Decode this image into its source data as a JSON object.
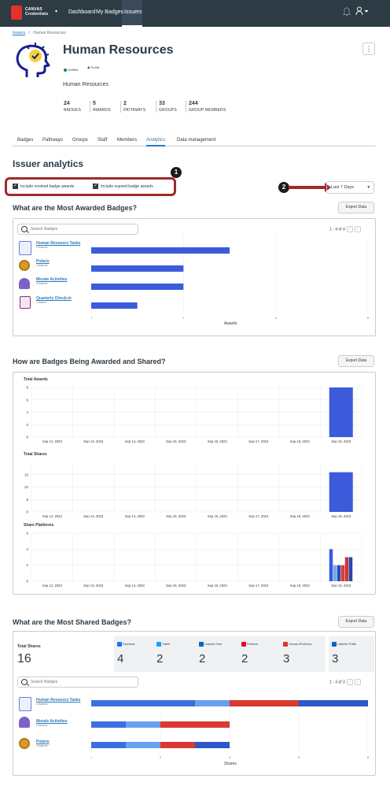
{
  "topbar": {
    "brand_line1": "CANVAS",
    "brand_line2": "Credentials",
    "nav": [
      "Dashboard",
      "My Badges",
      "Issuers"
    ]
  },
  "breadcrumb": {
    "root": "Issuers",
    "separator": "/",
    "current": "Human Resources"
  },
  "issuer": {
    "title": "Human Resources",
    "verified": "Verified",
    "visibility": "Public",
    "description": "Human Resources",
    "menu": "⋮"
  },
  "stats": [
    {
      "value": "24",
      "label": "BADGES"
    },
    {
      "value": "5",
      "label": "AWARDS"
    },
    {
      "value": "2",
      "label": "PATHWAYS"
    },
    {
      "value": "33",
      "label": "GROUPS"
    },
    {
      "value": "244",
      "label": "GROUP MEMBERS"
    }
  ],
  "tabs": [
    "Badges",
    "Pathways",
    "Groups",
    "Staff",
    "Members",
    "Analytics",
    "Data management"
  ],
  "active_tab": "Analytics",
  "analytics": {
    "heading": "Issuer analytics",
    "checkbox_revoked": "Include revoked badge awards",
    "checkbox_expired": "Include expired badge awards",
    "range_select": "Last 7 Days",
    "callout_1": "1",
    "callout_2": "2"
  },
  "most_awarded": {
    "heading": "What are the Most Awarded Badges?",
    "export": "Export Data",
    "search_placeholder": "Search Badges",
    "pager": "1 - 4 of 4",
    "xlabel": "Awards"
  },
  "awarded_shared": {
    "heading": "How are Badges Being Awarded and Shared?",
    "export": "Export Data"
  },
  "most_shared": {
    "heading": "What are the Most Shared Badges?",
    "export": "Export Data",
    "total_label": "Total Shares",
    "total_value": "16",
    "platforms": [
      {
        "name": "Facebook",
        "value": "4",
        "color": "#1877f2"
      },
      {
        "name": "Twitter",
        "value": "2",
        "color": "#1da1f2"
      },
      {
        "name": "LinkedIn Feed",
        "value": "2",
        "color": "#0a66c2"
      },
      {
        "name": "Pinterest",
        "value": "2",
        "color": "#e60023"
      },
      {
        "name": "Canvas ePortfolios",
        "value": "3",
        "color": "#e4312c"
      },
      {
        "name": "LinkedIn Profile",
        "value": "3",
        "color": "#0a66c2"
      }
    ],
    "search_placeholder": "Search Badges",
    "pager": "1 - 3 of 3",
    "xlabel": "Shares"
  },
  "chart_data": [
    {
      "type": "bar",
      "title": "What are the Most Awarded Badges?",
      "orientation": "horizontal",
      "categories": [
        "Human Resource Tasks",
        "Polaris",
        "Morale Activities",
        "Quarterly Check-in"
      ],
      "subtitles": [
        "3 Awards",
        "2 Awards",
        "2 Awards",
        "1 Award"
      ],
      "values": [
        3,
        2,
        2,
        1
      ],
      "xlabel": "Awards",
      "xlim": [
        0,
        6
      ],
      "xticks": [
        "0",
        "2",
        "4",
        "6"
      ],
      "color": "#3b5bdb"
    },
    {
      "type": "bar",
      "title": "Total Awards",
      "categories": [
        "Sep 12, 2023",
        "Sep 13, 2023",
        "Sep 14, 2023",
        "Sep 15, 2023",
        "Sep 16, 2023",
        "Sep 17, 2023",
        "Sep 18, 2023",
        "Sep 19, 2023"
      ],
      "values": [
        0,
        0,
        0,
        0,
        0,
        0,
        0,
        8
      ],
      "ylim": [
        0,
        8
      ],
      "yticks": [
        "0",
        "2",
        "4",
        "6",
        "8"
      ],
      "color": "#3b5bdb"
    },
    {
      "type": "bar",
      "title": "Total Shares",
      "categories": [
        "Sep 12, 2023",
        "Sep 13, 2023",
        "Sep 14, 2023",
        "Sep 15, 2023",
        "Sep 16, 2023",
        "Sep 17, 2023",
        "Sep 18, 2023",
        "Sep 19, 2023"
      ],
      "values": [
        0,
        0,
        0,
        0,
        0,
        0,
        0,
        16
      ],
      "ylim": [
        0,
        20
      ],
      "yticks": [
        "0",
        "5",
        "10",
        "15"
      ],
      "color": "#3b5bdb"
    },
    {
      "type": "bar",
      "title": "Share Platforms",
      "categories": [
        "Sep 12, 2023",
        "Sep 13, 2023",
        "Sep 14, 2023",
        "Sep 15, 2023",
        "Sep 16, 2023",
        "Sep 17, 2023",
        "Sep 18, 2023",
        "Sep 19, 2023"
      ],
      "series": [
        {
          "values": [
            0,
            0,
            0,
            0,
            0,
            0,
            0,
            4
          ],
          "color": "#3b5bdb"
        },
        {
          "values": [
            0,
            0,
            0,
            0,
            0,
            0,
            0,
            2
          ],
          "color": "#7aa7e8"
        },
        {
          "values": [
            0,
            0,
            0,
            0,
            0,
            0,
            0,
            2
          ],
          "color": "#1f4fbf"
        },
        {
          "values": [
            0,
            0,
            0,
            0,
            0,
            0,
            0,
            2
          ],
          "color": "#e03b2f"
        },
        {
          "values": [
            0,
            0,
            0,
            0,
            0,
            0,
            0,
            3
          ],
          "color": "#c43a3a"
        },
        {
          "values": [
            0,
            0,
            0,
            0,
            0,
            0,
            0,
            3
          ],
          "color": "#2a44a8"
        }
      ],
      "ylim": [
        0,
        6
      ],
      "yticks": [
        "0",
        "2",
        "4",
        "6"
      ]
    },
    {
      "type": "bar",
      "title": "What are the Most Shared Badges?",
      "orientation": "horizontal",
      "stacked": true,
      "categories": [
        "Human Resource Tasks",
        "Morale Activities",
        "Polaris"
      ],
      "subtitles": [
        "3 Awards",
        "2 Awards",
        "2 Awards"
      ],
      "series": [
        {
          "values": [
            3,
            1,
            1
          ],
          "color": "#3b6fe0"
        },
        {
          "values": [
            1,
            1,
            1
          ],
          "color": "#6aa0f0"
        },
        {
          "values": [
            2,
            2,
            1
          ],
          "color": "#d9392f"
        },
        {
          "values": [
            2,
            0,
            1
          ],
          "color": "#2b57c9"
        }
      ],
      "xlabel": "Shares",
      "xlim": [
        0,
        8
      ],
      "xticks": [
        "0",
        "2",
        "4",
        "6",
        "8"
      ]
    }
  ]
}
